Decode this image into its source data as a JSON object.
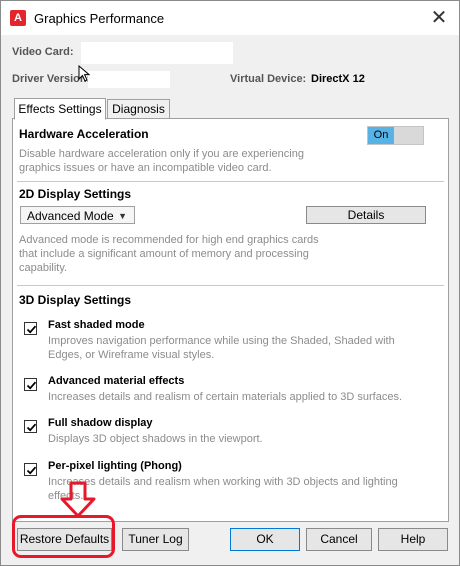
{
  "window": {
    "title": "Graphics Performance",
    "close_glyph": "✕",
    "app_icon_letter": "A"
  },
  "info": {
    "video_card_label": "Video Card:",
    "video_card_value": "",
    "driver_version_label": "Driver Version:",
    "driver_version_value": "",
    "virtual_device_label": "Virtual Device:",
    "virtual_device_value": "DirectX 12"
  },
  "tabs": [
    {
      "label": "Effects Settings",
      "active": true
    },
    {
      "label": "Diagnosis",
      "active": false
    }
  ],
  "hardware": {
    "title": "Hardware Acceleration",
    "toggle_label": "On",
    "desc_line1": "Disable hardware acceleration only if you are experiencing",
    "desc_line2": "graphics issues or have an incompatible video card."
  },
  "display2d": {
    "title": "2D Display Settings",
    "mode_selected": "Advanced Mode",
    "details_label": "Details",
    "desc_line1": "Advanced mode is recommended for high end graphics cards",
    "desc_line2": "that include a significant amount of memory and processing",
    "desc_line3": "capability."
  },
  "display3d": {
    "title": "3D Display Settings",
    "options": [
      {
        "title": "Fast shaded mode",
        "checked": true,
        "desc_line1": "Improves navigation performance while using the Shaded, Shaded with",
        "desc_line2": "Edges, or Wireframe visual styles."
      },
      {
        "title": "Advanced material effects",
        "checked": true,
        "desc_line1": "Increases details and realism of certain materials applied to 3D surfaces.",
        "desc_line2": ""
      },
      {
        "title": "Full shadow display",
        "checked": true,
        "desc_line1": "Displays 3D object shadows in the viewport.",
        "desc_line2": ""
      },
      {
        "title": "Per-pixel lighting (Phong)",
        "checked": true,
        "desc_line1": "Increases details and realism when working with 3D objects and lighting",
        "desc_line2": "effects."
      }
    ]
  },
  "footer": {
    "restore_defaults": "Restore Defaults",
    "tuner_log": "Tuner Log",
    "ok": "OK",
    "cancel": "Cancel",
    "help": "Help"
  },
  "colors": {
    "toggle_on": "#57b2e6",
    "annotation_red": "#e8182b",
    "app_icon": "#e3262e"
  }
}
